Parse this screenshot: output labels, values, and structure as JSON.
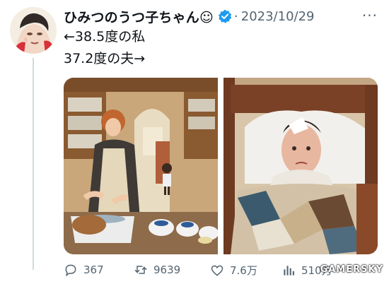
{
  "tweet": {
    "display_name": "ひみつのうつ子ちゃん☺",
    "separator": "·",
    "date": "2023/10/29",
    "more_label": "···",
    "lines": [
      "←38.5度の私",
      "37.2度の夫→"
    ]
  },
  "actions": {
    "reply_count": "367",
    "retweet_count": "9639",
    "like_count": "7.6万",
    "view_count": "510万"
  },
  "watermark": "GAMERSKY",
  "icons": {
    "avatar": "avatar-illustration",
    "verified": "verified-badge-icon",
    "reply": "reply-icon",
    "retweet": "retweet-icon",
    "like": "heart-icon",
    "views": "views-icon"
  },
  "colors": {
    "verified": "#1d9bf0",
    "meta_text": "#536471",
    "divider": "#cfd9de"
  }
}
